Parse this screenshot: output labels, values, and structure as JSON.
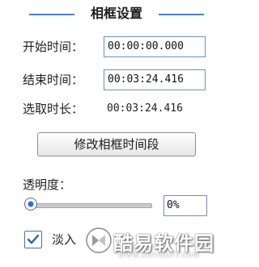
{
  "section": {
    "title": "相框设置"
  },
  "start": {
    "label": "开始时间：",
    "value": "00:00:00.000"
  },
  "end": {
    "label": "结束时间：",
    "value": "00:03:24.416"
  },
  "duration": {
    "label": "选取时长：",
    "value": "00:03:24.416"
  },
  "modify_button": {
    "label": "修改相框时间段"
  },
  "opacity": {
    "label": "透明度：",
    "value": "0%",
    "level": 0
  },
  "fade_in": {
    "label": "淡入",
    "checked": true
  },
  "watermark": {
    "text": "酷易软件园",
    "sub": "WWW.KUYISOFT.COM"
  },
  "colors": {
    "accent": "#4d7fc4",
    "field_border": "#6c8fc4"
  }
}
